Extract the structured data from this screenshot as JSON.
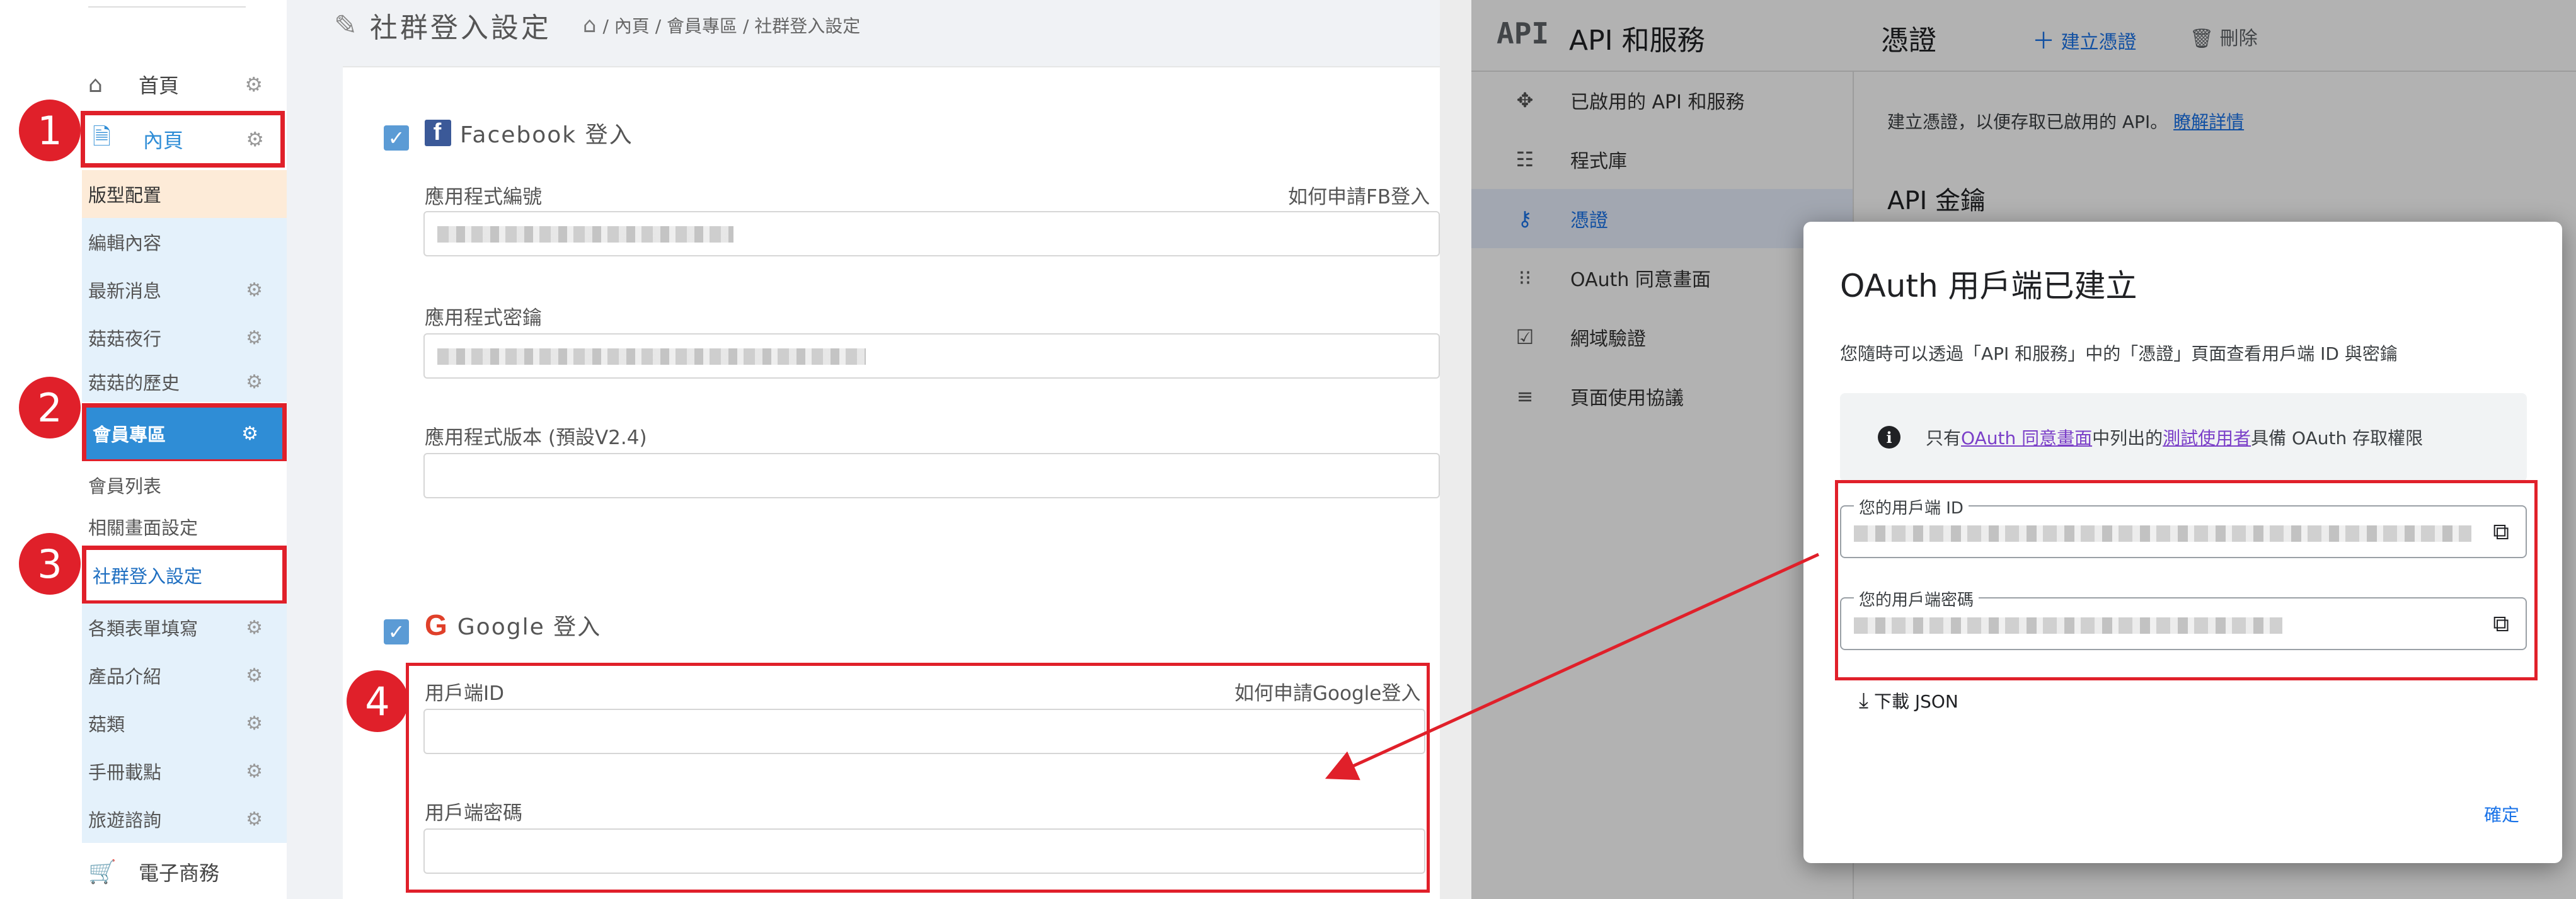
{
  "cms": {
    "header": {
      "title": "社群登入設定",
      "breadcrumb": "/ 內頁 / 會員專區 / 社群登入設定"
    },
    "sidebar": {
      "home": "首頁",
      "inner_page": "內頁",
      "template_config": "版型配置",
      "edit_content": "編輯內容",
      "latest_news": "最新消息",
      "mushroom_night": "菇菇夜行",
      "mushroom_history": "菇菇的歷史",
      "member_zone": "會員專區",
      "member_list": "會員列表",
      "related_page_settings": "相關畫面設定",
      "social_login_settings": "社群登入設定",
      "forms": "各類表單填寫",
      "products": "產品介紹",
      "mushroom_types": "菇類",
      "manual_download": "手冊載點",
      "travel_inquiry": "旅遊諮詢",
      "ecommerce": "電子商務"
    },
    "badges": [
      "1",
      "2",
      "3",
      "4"
    ],
    "facebook": {
      "title": "Facebook 登入",
      "app_id_label": "應用程式編號",
      "help_link": "如何申請FB登入",
      "app_secret_label": "應用程式密鑰",
      "app_version_label": "應用程式版本 (預設V2.4)"
    },
    "google": {
      "title": "Google 登入",
      "client_id_label": "用戶端ID",
      "help_link": "如何申請Google登入",
      "client_secret_label": "用戶端密碼"
    }
  },
  "console": {
    "logo": "API",
    "product_title": "API 和服務",
    "page_title": "憑證",
    "create_credentials": "建立憑證",
    "delete": "刪除",
    "nav": {
      "enabled_apis": "已啟用的 API 和服務",
      "library": "程式庫",
      "credentials": "憑證",
      "oauth_consent": "OAuth 同意畫面",
      "domain_verification": "網域驗證",
      "page_usage": "頁面使用協議"
    },
    "subtitle_prefix": "建立憑證，以便存取已啟用的 API。",
    "learn_more": "瞭解詳情",
    "api_keys": "API 金鑰",
    "dialog": {
      "title": "OAuth 用戶端已建立",
      "description": "您隨時可以透過「API 和服務」中的「憑證」頁面查看用戶端 ID 與密鑰",
      "info_prefix": "只有",
      "info_link1": "OAuth 同意畫面",
      "info_mid": "中列出的",
      "info_link2": "測試使用者",
      "info_suffix": "具備 OAuth 存取權限",
      "client_id_label": "您的用戶端 ID",
      "client_secret_label": "您的用戶端密碼",
      "download_json": "下載 JSON",
      "confirm": "確定"
    }
  },
  "colors": {
    "highlight_red": "#e0202a",
    "sidebar_active_blue": "#2f8dd6",
    "google_blue": "#1a73e8"
  },
  "icons": [
    "home-icon",
    "document-icon",
    "gear-icon",
    "cart-icon",
    "pin-icon",
    "facebook-icon",
    "google-icon",
    "checkbox-icon",
    "move-icon",
    "library-icon",
    "key-icon",
    "consent-icon",
    "verify-icon",
    "settings-list-icon",
    "plus-icon",
    "trash-icon",
    "info-icon",
    "copy-icon",
    "download-icon"
  ]
}
